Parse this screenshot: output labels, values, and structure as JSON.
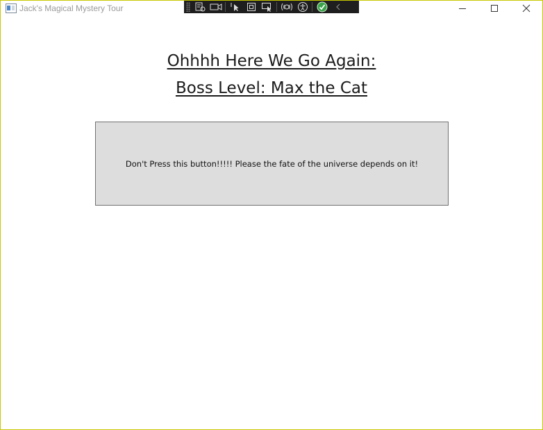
{
  "window": {
    "title": "Jack's Magical Mystery Tour",
    "border_color": "#c8c800"
  },
  "debug_toolbar": {
    "icons": [
      "live-visual-tree-icon",
      "video-icon",
      "select-element-icon",
      "display-layout-adorners-icon",
      "track-focused-element-icon",
      "hot-reload-icon",
      "accessibility-icon",
      "binding-check-icon",
      "collapse-chevron-icon"
    ]
  },
  "heading": {
    "line1": "Ohhhh Here We Go Again:",
    "line2": "Boss Level: Max the Cat"
  },
  "main_button": {
    "label": "Don't Press this button!!!!! Please the fate of the universe depends on it!",
    "background": "#dddddd"
  }
}
